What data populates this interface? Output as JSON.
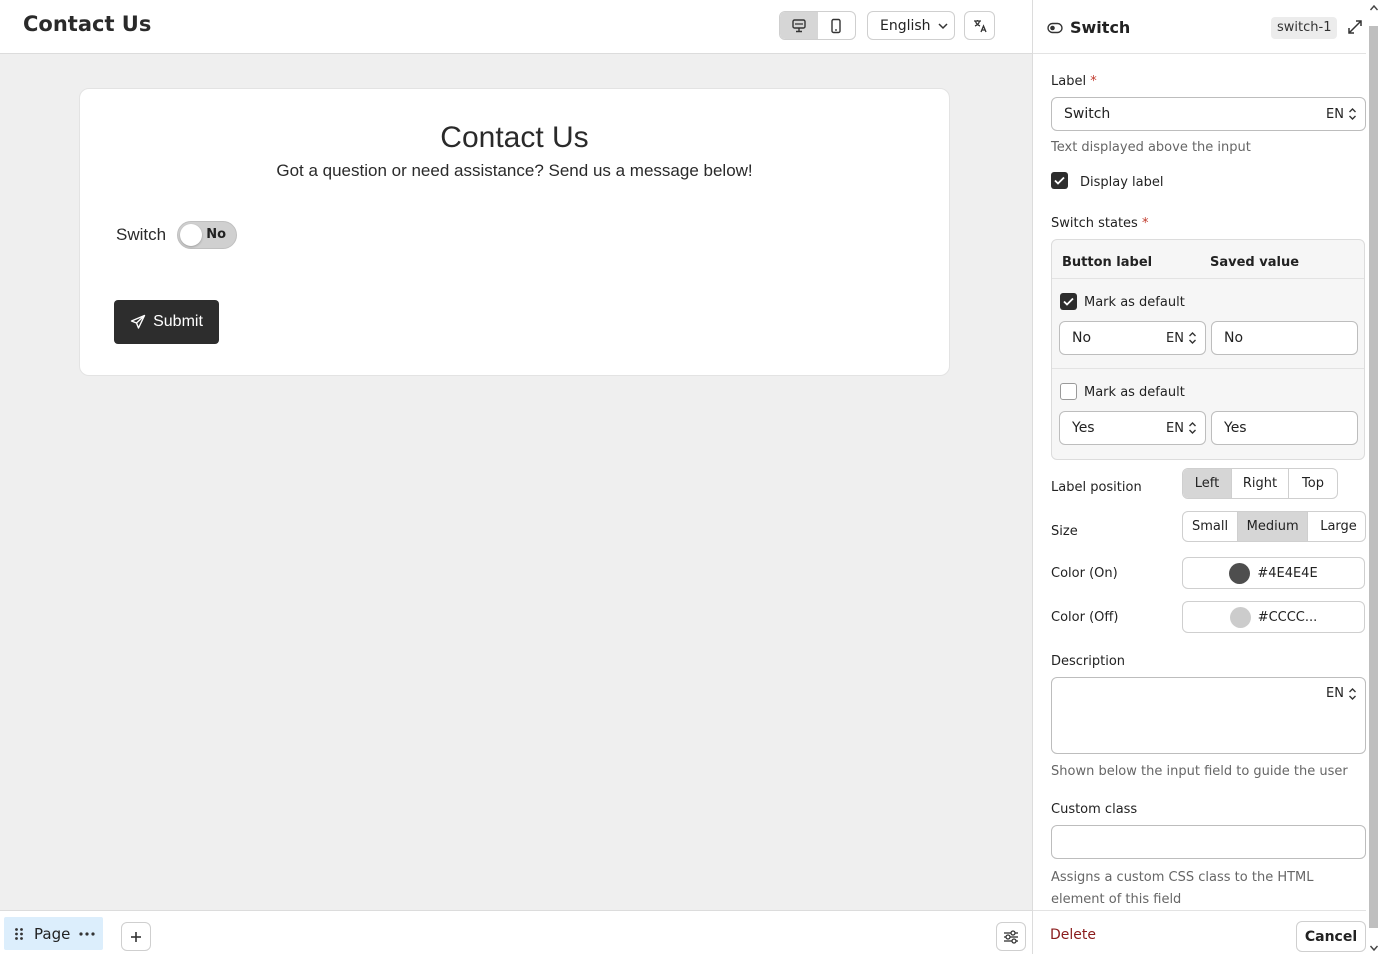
{
  "header": {
    "title": "Contact Us",
    "language": "English",
    "translate_icon": "translate-icon",
    "device_modes": [
      "desktop",
      "mobile"
    ],
    "active_device": "desktop"
  },
  "form": {
    "title": "Contact Us",
    "subtitle": "Got a question or need assistance? Send us a message below!",
    "switch_label": "Switch",
    "switch_state": "No",
    "submit_label": "Submit"
  },
  "footer": {
    "page_label": "Page",
    "add_icon": "plus-icon",
    "settings_icon": "sliders-icon"
  },
  "panel": {
    "title": "Switch",
    "component_id": "switch-1",
    "label": {
      "title": "Label",
      "value": "Switch",
      "lang": "EN",
      "hint": "Text displayed above the input"
    },
    "display_label": {
      "text": "Display label",
      "checked": true
    },
    "switch_states": {
      "title": "Switch states",
      "col_button_label": "Button label",
      "col_saved_value": "Saved value",
      "states": [
        {
          "default_text": "Mark as default",
          "is_default": true,
          "label": "No",
          "lang": "EN",
          "value": "No"
        },
        {
          "default_text": "Mark as default",
          "is_default": false,
          "label": "Yes",
          "lang": "EN",
          "value": "Yes"
        }
      ]
    },
    "label_position": {
      "title": "Label position",
      "options": [
        "Left",
        "Right",
        "Top"
      ],
      "selected": "Left"
    },
    "size": {
      "title": "Size",
      "options": [
        "Small",
        "Medium",
        "Large"
      ],
      "selected": "Medium"
    },
    "color_on": {
      "title": "Color (On)",
      "value": "#4E4E4E",
      "swatch": "#4e4e4e"
    },
    "color_off": {
      "title": "Color (Off)",
      "value": "#CCCC...",
      "swatch": "#cccccc"
    },
    "description": {
      "title": "Description",
      "lang": "EN",
      "value": "",
      "hint": "Shown below the input field to guide the user"
    },
    "custom_class": {
      "title": "Custom class",
      "value": "",
      "hint": "Assigns a custom CSS class to the HTML element of this field"
    },
    "delete_label": "Delete",
    "cancel_label": "Cancel"
  }
}
